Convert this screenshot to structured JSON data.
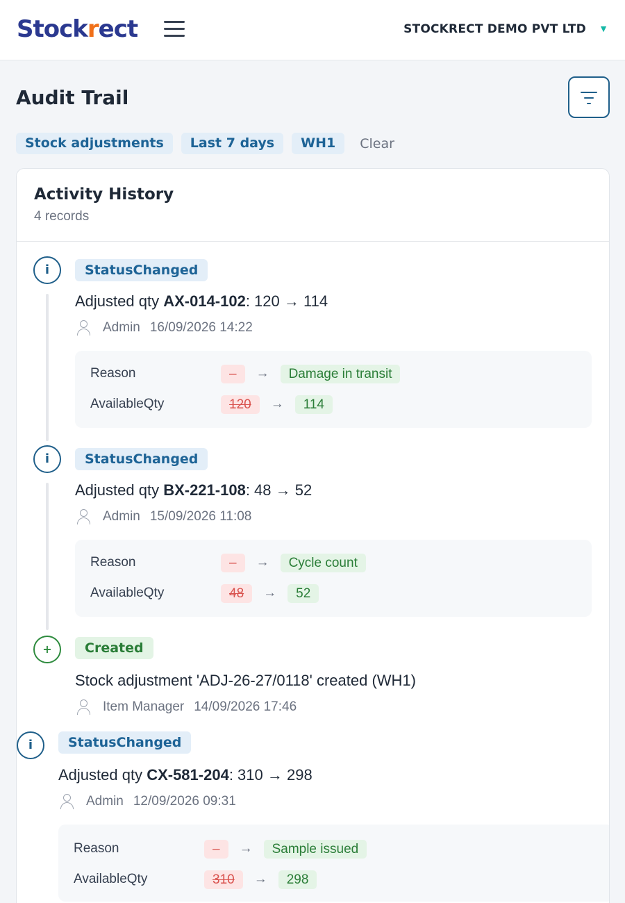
{
  "header": {
    "logo_main": "Stock",
    "logo_tick": "r",
    "logo_rest": "ect",
    "company": "STOCKRECT DEMO PVT LTD",
    "menu_icon": "hamburger-icon",
    "caret_icon": "triangle-down-icon",
    "caret_color": "#14b8a6",
    "brand_color": "#2b3990",
    "accent_color": "#f0701a"
  },
  "page": {
    "title": "Audit Trail",
    "filter_icon": "filter-icon"
  },
  "filters": {
    "chips": [
      "Stock adjustments",
      "Last 7 days",
      "WH1"
    ],
    "clear_label": "Clear"
  },
  "card": {
    "title": "Activity History",
    "subtitle": "4 records"
  },
  "entries": [
    {
      "type": "StatusChanged",
      "icon": "info-icon",
      "icon_glyph": "i",
      "message_prefix": "Adjusted qty ",
      "message_bold": "AX-014-102",
      "message_suffix": ": 120 → 114",
      "user": "Admin",
      "timestamp": "16/09/2026 14:22",
      "changes": [
        {
          "field": "Reason",
          "old": "–",
          "arrow": "→",
          "new": "Damage in transit"
        },
        {
          "field": "AvailableQty",
          "old": "120",
          "arrow": "→",
          "new": "114"
        }
      ]
    },
    {
      "type": "StatusChanged",
      "icon": "info-icon",
      "icon_glyph": "i",
      "message_prefix": "Adjusted qty ",
      "message_bold": "BX-221-108",
      "message_suffix": ": 48 → 52",
      "user": "Admin",
      "timestamp": "15/09/2026 11:08",
      "changes": [
        {
          "field": "Reason",
          "old": "–",
          "arrow": "→",
          "new": "Cycle count"
        },
        {
          "field": "AvailableQty",
          "old": "48",
          "arrow": "→",
          "new": "52"
        }
      ]
    },
    {
      "type": "Created",
      "icon": "plus-icon",
      "icon_glyph": "+",
      "message_prefix": "Stock adjustment 'ADJ-26-27/0118' created (WH1)",
      "message_bold": "",
      "message_suffix": "",
      "user": "Item Manager",
      "timestamp": "14/09/2026 17:46",
      "changes": []
    },
    {
      "type": "StatusChanged",
      "icon": "info-icon",
      "icon_glyph": "i",
      "message_prefix": "Adjusted qty ",
      "message_bold": "CX-581-204",
      "message_suffix": ": 310 → 298",
      "user": "Admin",
      "timestamp": "12/09/2026 09:31",
      "changes": [
        {
          "field": "Reason",
          "old": "–",
          "arrow": "→",
          "new": "Sample issued"
        },
        {
          "field": "AvailableQty",
          "old": "310",
          "arrow": "→",
          "new": "298"
        }
      ]
    }
  ]
}
